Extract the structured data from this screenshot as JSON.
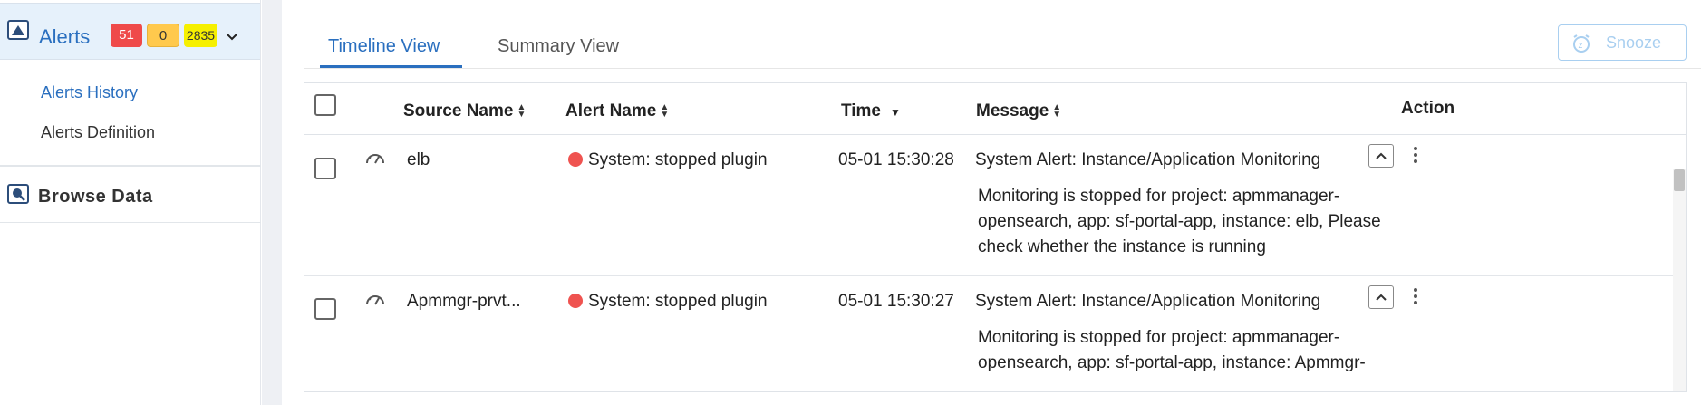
{
  "sidebar": {
    "alerts": {
      "label": "Alerts",
      "badges": {
        "critical": "51",
        "warning": "0",
        "info": "2835"
      },
      "icon": "alerts-icon"
    },
    "sub_items": [
      "Alerts History",
      "Alerts Definition"
    ],
    "browse": {
      "label": "Browse Data",
      "icon": "browse-data-icon"
    }
  },
  "tabs": {
    "timeline": "Timeline View",
    "summary": "Summary View"
  },
  "snooze_label": "Snooze",
  "table": {
    "headers": {
      "source": "Source Name",
      "alert": "Alert Name",
      "time": "Time",
      "message": "Message",
      "action": "Action"
    },
    "rows": [
      {
        "source": "elb",
        "alert": "System: stopped plugin",
        "time": "05-01 15:30:28",
        "message": "System Alert: Instance/Application Monitoring",
        "detail": "Monitoring is stopped for project: apmmanager-opensearch, app: sf-portal-app, instance: elb, Please check whether the instance is running"
      },
      {
        "source": "Apmmgr-prvt...",
        "alert": "System: stopped plugin",
        "time": "05-01 15:30:27",
        "message": "System Alert: Instance/Application Monitoring",
        "detail": "Monitoring is stopped for project: apmmanager-opensearch, app: sf-portal-app, instance: Apmmgr-"
      }
    ]
  },
  "colors": {
    "accent": "#2a6fbf",
    "critical": "#ef4a4a",
    "warning": "#ffc94d",
    "info": "#f6f000",
    "status_dot": "#ef5350"
  }
}
